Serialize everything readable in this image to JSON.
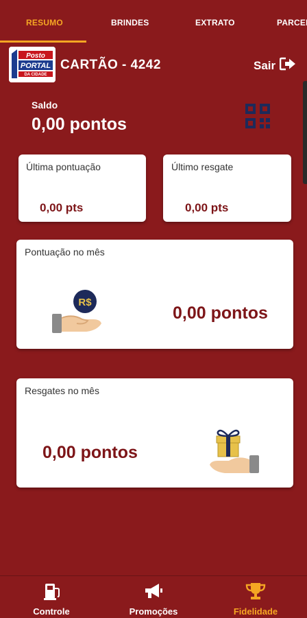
{
  "tabs": [
    {
      "label": "RESUMO",
      "active": true
    },
    {
      "label": "BRINDES",
      "active": false
    },
    {
      "label": "EXTRATO",
      "active": false
    },
    {
      "label": "PARCEI",
      "active": false
    }
  ],
  "header": {
    "logo_text_top": "Posto",
    "logo_text_main": "PORTAL",
    "logo_text_sub": "DA CIDADE",
    "card_title": "CARTÃO - 4242",
    "logout_label": "Sair"
  },
  "balance": {
    "label": "Saldo",
    "value": "0,00 pontos"
  },
  "last_points": {
    "label": "Última pontuação",
    "value": "0,00 pts"
  },
  "last_redeem": {
    "label": "Último resgate",
    "value": "0,00 pts"
  },
  "month_points": {
    "label": "Pontuação no mês",
    "value": "0,00 pontos",
    "coin_text": "R$"
  },
  "month_redeem": {
    "label": "Resgates no mês",
    "value": "0,00 pontos"
  },
  "bottom_nav": [
    {
      "label": "Controle",
      "icon": "gas-pump-icon",
      "active": false
    },
    {
      "label": "Promoções",
      "icon": "megaphone-icon",
      "active": false
    },
    {
      "label": "Fidelidade",
      "icon": "trophy-icon",
      "active": true
    }
  ],
  "colors": {
    "background": "#8a1a1c",
    "accent": "#f5a623",
    "value_text": "#7d1518",
    "qr": "#1d2a5a"
  }
}
